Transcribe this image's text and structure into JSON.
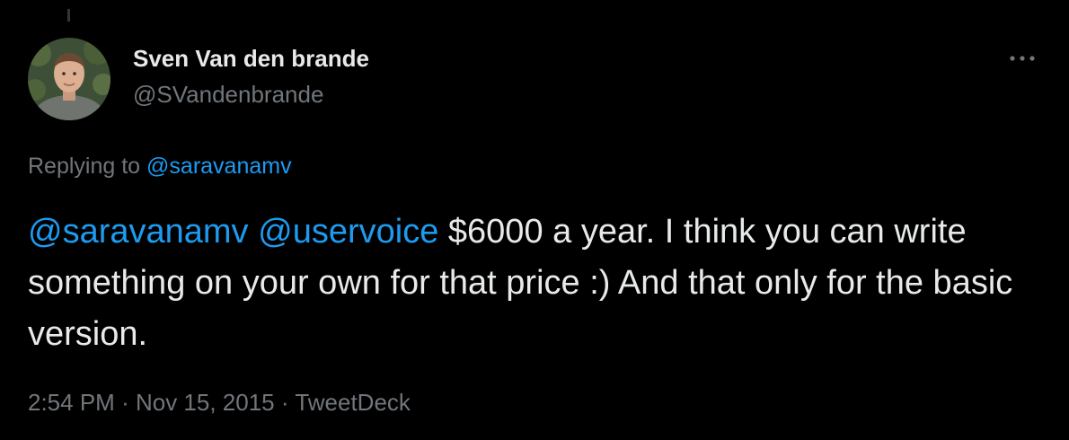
{
  "author": {
    "display_name": "Sven Van den brande",
    "handle": "@SVandenbrande"
  },
  "more_icon": "more-horizontal-icon",
  "replying": {
    "prefix": "Replying to",
    "mention": "@saravanamv"
  },
  "tweet": {
    "mention_1": "@saravanamv",
    "mention_2": "@uservoice",
    "text": "$6000 a year. I think you can write something on your own for that price :) And that only for the basic version."
  },
  "meta": {
    "time": "2:54 PM",
    "separator": "·",
    "date": "Nov 15, 2015",
    "source": "TweetDeck"
  },
  "colors": {
    "background": "#000000",
    "primary_text": "#e7e9ea",
    "secondary_text": "#71767b",
    "link": "#1d9bf0"
  }
}
